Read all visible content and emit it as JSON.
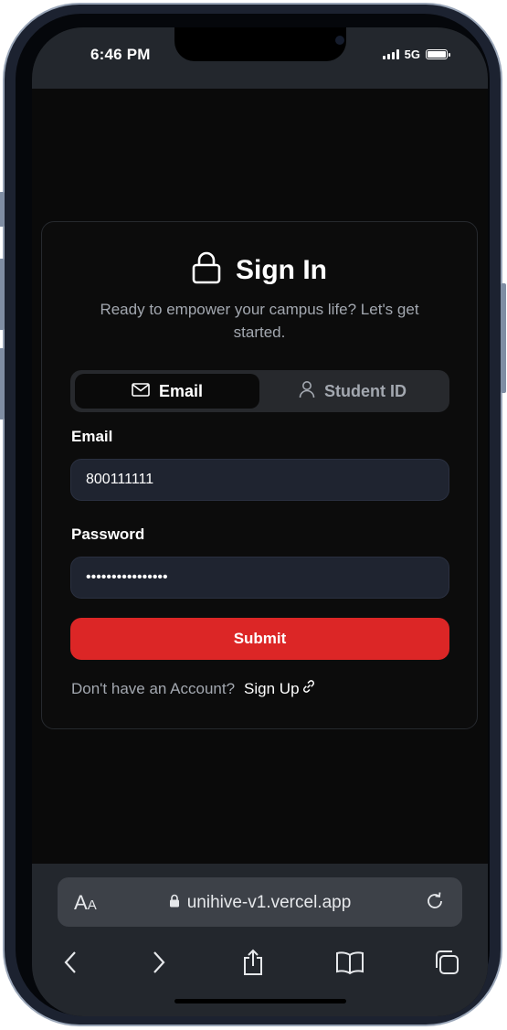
{
  "status_bar": {
    "time": "6:46 PM",
    "network": "5G"
  },
  "signin": {
    "title": "Sign In",
    "subtitle": "Ready to empower your campus life? Let's get started.",
    "tabs": [
      {
        "label": "Email",
        "icon": "mail-icon",
        "active": true
      },
      {
        "label": "Student ID",
        "icon": "user-icon",
        "active": false
      }
    ],
    "email_label": "Email",
    "email_value": "800111111",
    "password_label": "Password",
    "password_value": "••••••••••••••••",
    "submit_label": "Submit",
    "signup_question": "Don't have an Account?",
    "signup_link": "Sign Up"
  },
  "browser": {
    "text_size_label": "AA",
    "url": "unihive-v1.vercel.app",
    "toolbar_icons": [
      "back-icon",
      "forward-icon",
      "share-icon",
      "bookmarks-icon",
      "tabs-icon"
    ]
  },
  "colors": {
    "accent": "#dc2626",
    "field_bg": "#1f2430",
    "screen_bg": "#0a0a0a",
    "muted_text": "#a3a8b0"
  }
}
